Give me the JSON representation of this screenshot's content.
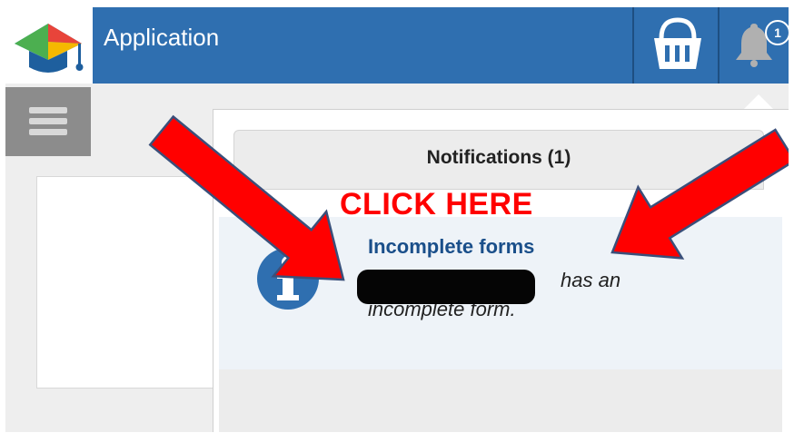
{
  "header": {
    "app_title": "Application",
    "icons": {
      "logo": "graduation-cap-logo",
      "cart": "basket-icon",
      "notifications": "bell-icon"
    },
    "notification_count": "1"
  },
  "notifications_panel": {
    "title": "Notifications (1)",
    "items": [
      {
        "icon": "info-icon",
        "title": "Incomplete forms",
        "body_visible": "has an incomplete form."
      }
    ]
  },
  "annotation": {
    "callout": "CLICK HERE",
    "arrow_color": "#ff0000"
  },
  "colors": {
    "header_bg": "#2f6fb0",
    "link": "#1a4f8a",
    "callout": "#ff0000"
  }
}
